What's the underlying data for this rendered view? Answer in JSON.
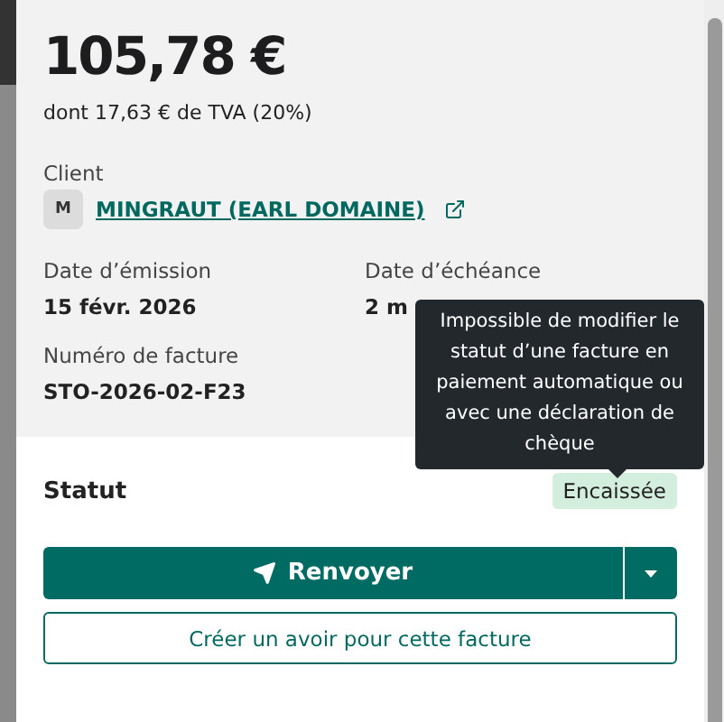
{
  "invoice": {
    "amount": "105,78 €",
    "vat_note": "dont 17,63 € de TVA (20%)",
    "client": {
      "label": "Client",
      "initial": "M",
      "name": "MINGRAUT (EARL DOMAINE)"
    },
    "fields": [
      {
        "label": "Date d’émission",
        "value": "15 févr. 2026"
      },
      {
        "label": "Date d’échéance",
        "value": "2 m"
      },
      {
        "label": "Numéro de facture",
        "value": "STO-2026-02-F23"
      }
    ]
  },
  "tooltip": "Impossible de modifier le statut d’une facture en paiement automatique ou avec une déclaration de chèque",
  "status": {
    "label": "Statut",
    "value": "Encaissée"
  },
  "buttons": {
    "primary": "Renvoyer",
    "secondary": "Créer un avoir pour cette facture"
  }
}
